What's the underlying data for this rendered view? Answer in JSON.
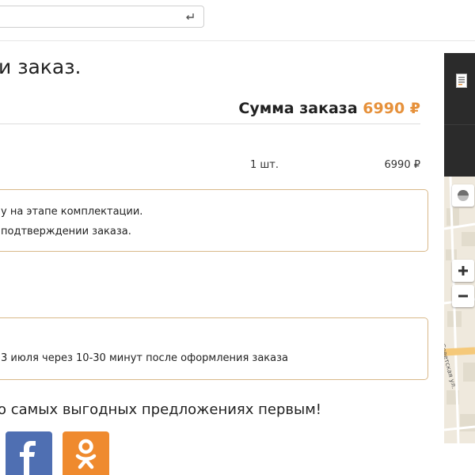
{
  "header": {
    "search": {
      "value": "",
      "enter_icon": "enter-key-icon"
    }
  },
  "page": {
    "title": "и заказ."
  },
  "order": {
    "sum_label": "Сумма заказа",
    "sum_amount": "6990 ₽",
    "item": {
      "qty": "1 шт.",
      "price": "6990 ₽"
    }
  },
  "notices": {
    "first": {
      "line1": "у на этапе комплектации.",
      "line2": "подтверждении заказа."
    },
    "second": {
      "line1": "3 июля через 10-30 минут после оформления заказа"
    }
  },
  "promo": {
    "text": "о самых выгодных предложениях первым!",
    "buttons": [
      {
        "icon": "facebook-icon",
        "color": "#4f6fb2"
      },
      {
        "icon": "odnoklassniki-icon",
        "color": "#ef8a2e"
      }
    ]
  },
  "map": {
    "street_label": "Советская ул.",
    "zoom_in": "+",
    "zoom_out": "−",
    "compass_icon": "compass-icon"
  },
  "colors": {
    "accent": "#e6913b",
    "box_border": "#d9b98a",
    "dark_panel": "#2b2b2b"
  }
}
